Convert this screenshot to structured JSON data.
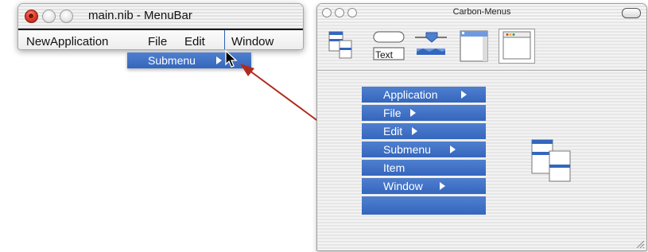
{
  "menubar_window": {
    "title": "main.nib - MenuBar",
    "menus": [
      "NewApplication",
      "File",
      "Edit",
      "Window"
    ],
    "dragged_item": "Submenu"
  },
  "palette_window": {
    "title": "Carbon-Menus",
    "toolbar": {
      "tools": [
        {
          "icon": "menus-palette-icon",
          "selected": true
        },
        {
          "icon": "controls-palette-icon",
          "text": "Text"
        },
        {
          "icon": "sliders-palette-icon"
        },
        {
          "icon": "windows-palette-icon"
        },
        {
          "icon": "enhanced-controls-palette-icon"
        }
      ]
    },
    "menu_items": [
      {
        "label": "Application",
        "has_submenu": true
      },
      {
        "label": "File",
        "has_submenu": true
      },
      {
        "label": "Edit",
        "has_submenu": true
      },
      {
        "label": "Submenu",
        "has_submenu": true
      },
      {
        "label": "Item",
        "has_submenu": false
      },
      {
        "label": "Window",
        "has_submenu": true
      },
      {
        "label": "",
        "has_submenu": false
      }
    ]
  },
  "colors": {
    "menu_blue": "#3a6cc0",
    "arrow_red": "#b22a1e",
    "close_red": "#e0402a"
  }
}
